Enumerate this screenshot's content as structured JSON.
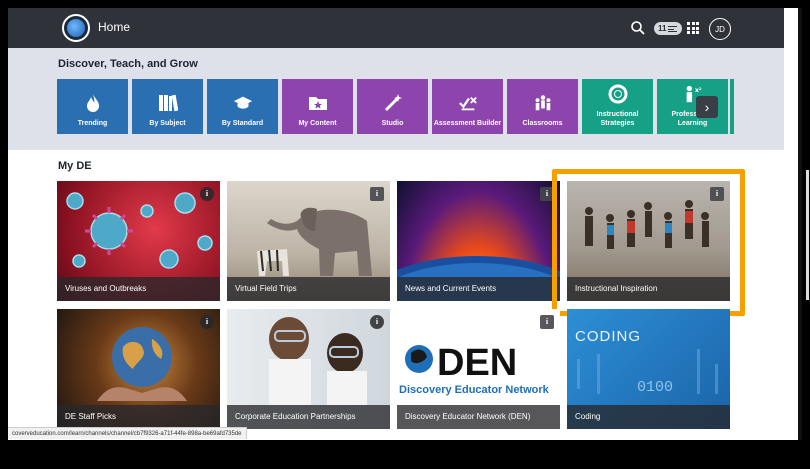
{
  "header": {
    "home_label": "Home",
    "notification_count": "11",
    "avatar_initials": "JD"
  },
  "discover": {
    "title": "Discover, Teach, and Grow",
    "tiles": [
      {
        "label": "Trending",
        "icon": "flame-icon",
        "color": "#2b6fb3"
      },
      {
        "label": "By Subject",
        "icon": "books-icon",
        "color": "#2b6fb3"
      },
      {
        "label": "By Standard",
        "icon": "graduation-cap-icon",
        "color": "#2b6fb3"
      },
      {
        "label": "My Content",
        "icon": "star-folder-icon",
        "color": "#8e44ad"
      },
      {
        "label": "Studio",
        "icon": "magic-wand-icon",
        "color": "#8e44ad"
      },
      {
        "label": "Assessment Builder",
        "icon": "check-x-icon",
        "color": "#8e44ad"
      },
      {
        "label": "Classrooms",
        "icon": "people-icon",
        "color": "#8e44ad"
      },
      {
        "label": "Instructional Strategies",
        "icon": "lifebuoy-icon",
        "color": "#16a085"
      },
      {
        "label": "Professional Learning",
        "icon": "learner-icon",
        "color": "#16a085"
      }
    ]
  },
  "myde": {
    "title": "My DE",
    "cards": [
      {
        "label": "Viruses and Outbreaks"
      },
      {
        "label": "Virtual Field Trips"
      },
      {
        "label": "News and Current Events"
      },
      {
        "label": "Instructional Inspiration"
      },
      {
        "label": "DE Staff Picks"
      },
      {
        "label": "Corporate Education Partnerships"
      },
      {
        "label": "Discovery Educator Network (DEN)"
      },
      {
        "label": "Coding"
      }
    ],
    "den_logo_text": "DEN",
    "den_logo_subtitle": "Discovery Educator Network",
    "coding_overlay_text": "CODING",
    "coding_digits": "0100"
  },
  "status_url": "coverveducation.com/learn/channels/channel/cb7f9326-a71f-44fe-898a-be69afd735de",
  "colors": {
    "highlight": "#f5a000",
    "header": "#2f3339",
    "discover_bg": "#dfe1ea"
  }
}
